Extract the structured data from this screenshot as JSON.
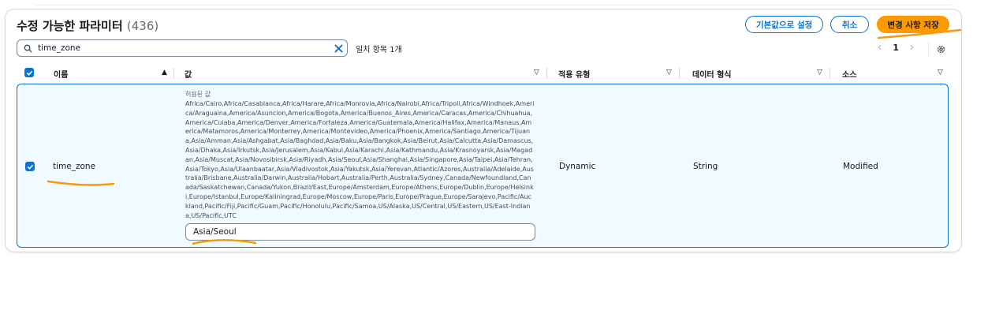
{
  "header": {
    "title": "수정 가능한 파라미터",
    "count": "(436)"
  },
  "actions": {
    "reset_label": "기본값으로 설정",
    "cancel_label": "취소",
    "save_label": "변경 사항 저장"
  },
  "search": {
    "value": "time_zone",
    "match_text": "일치 항목 1개"
  },
  "pagination": {
    "current": "1"
  },
  "columns": {
    "name": "이름",
    "value": "값",
    "apply_type": "적용 유형",
    "data_type": "데이터 형식",
    "source": "소스"
  },
  "row": {
    "name": "time_zone",
    "allowed_label": "허용된 값",
    "allowed_values": "Africa/Cairo,Africa/Casablanca,Africa/Harare,Africa/Monrovia,Africa/Nairobi,Africa/Tripoli,Africa/Windhoek,America/Araguaina,America/Asuncion,America/Bogota,America/Buenos_Aires,America/Caracas,America/Chihuahua,America/Cuiaba,America/Denver,America/Fortaleza,America/Guatemala,America/Halifax,America/Manaus,America/Matamoros,America/Monterrey,America/Montevideo,America/Phoenix,America/Santiago,America/Tijuana,Asia/Amman,Asia/Ashgabat,Asia/Baghdad,Asia/Baku,Asia/Bangkok,Asia/Beirut,Asia/Calcutta,Asia/Damascus,Asia/Dhaka,Asia/Irkutsk,Asia/Jerusalem,Asia/Kabul,Asia/Karachi,Asia/Kathmandu,Asia/Krasnoyarsk,Asia/Magadan,Asia/Muscat,Asia/Novosibirsk,Asia/Riyadh,Asia/Seoul,Asia/Shanghai,Asia/Singapore,Asia/Taipei,Asia/Tehran,Asia/Tokyo,Asia/Ulaanbaatar,Asia/Vladivostok,Asia/Yakutsk,Asia/Yerevan,Atlantic/Azores,Australia/Adelaide,Australia/Brisbane,Australia/Darwin,Australia/Hobart,Australia/Perth,Australia/Sydney,Canada/Newfoundland,Canada/Saskatchewan,Canada/Yukon,Brazil/East,Europe/Amsterdam,Europe/Athens,Europe/Dublin,Europe/Helsinki,Europe/Istanbul,Europe/Kaliningrad,Europe/Moscow,Europe/Paris,Europe/Prague,Europe/Sarajevo,Pacific/Auckland,Pacific/Fiji,Pacific/Guam,Pacific/Honolulu,Pacific/Samoa,US/Alaska,US/Central,US/Eastern,US/East-Indiana,US/Pacific,UTC",
    "value": "Asia/Seoul",
    "apply_type": "Dynamic",
    "data_type": "String",
    "source": "Modified"
  },
  "colors": {
    "accent": "#0972d3",
    "primary_button": "#ff9900",
    "row_selected_bg": "#f0fbff",
    "annotation": "#f59a0a"
  }
}
